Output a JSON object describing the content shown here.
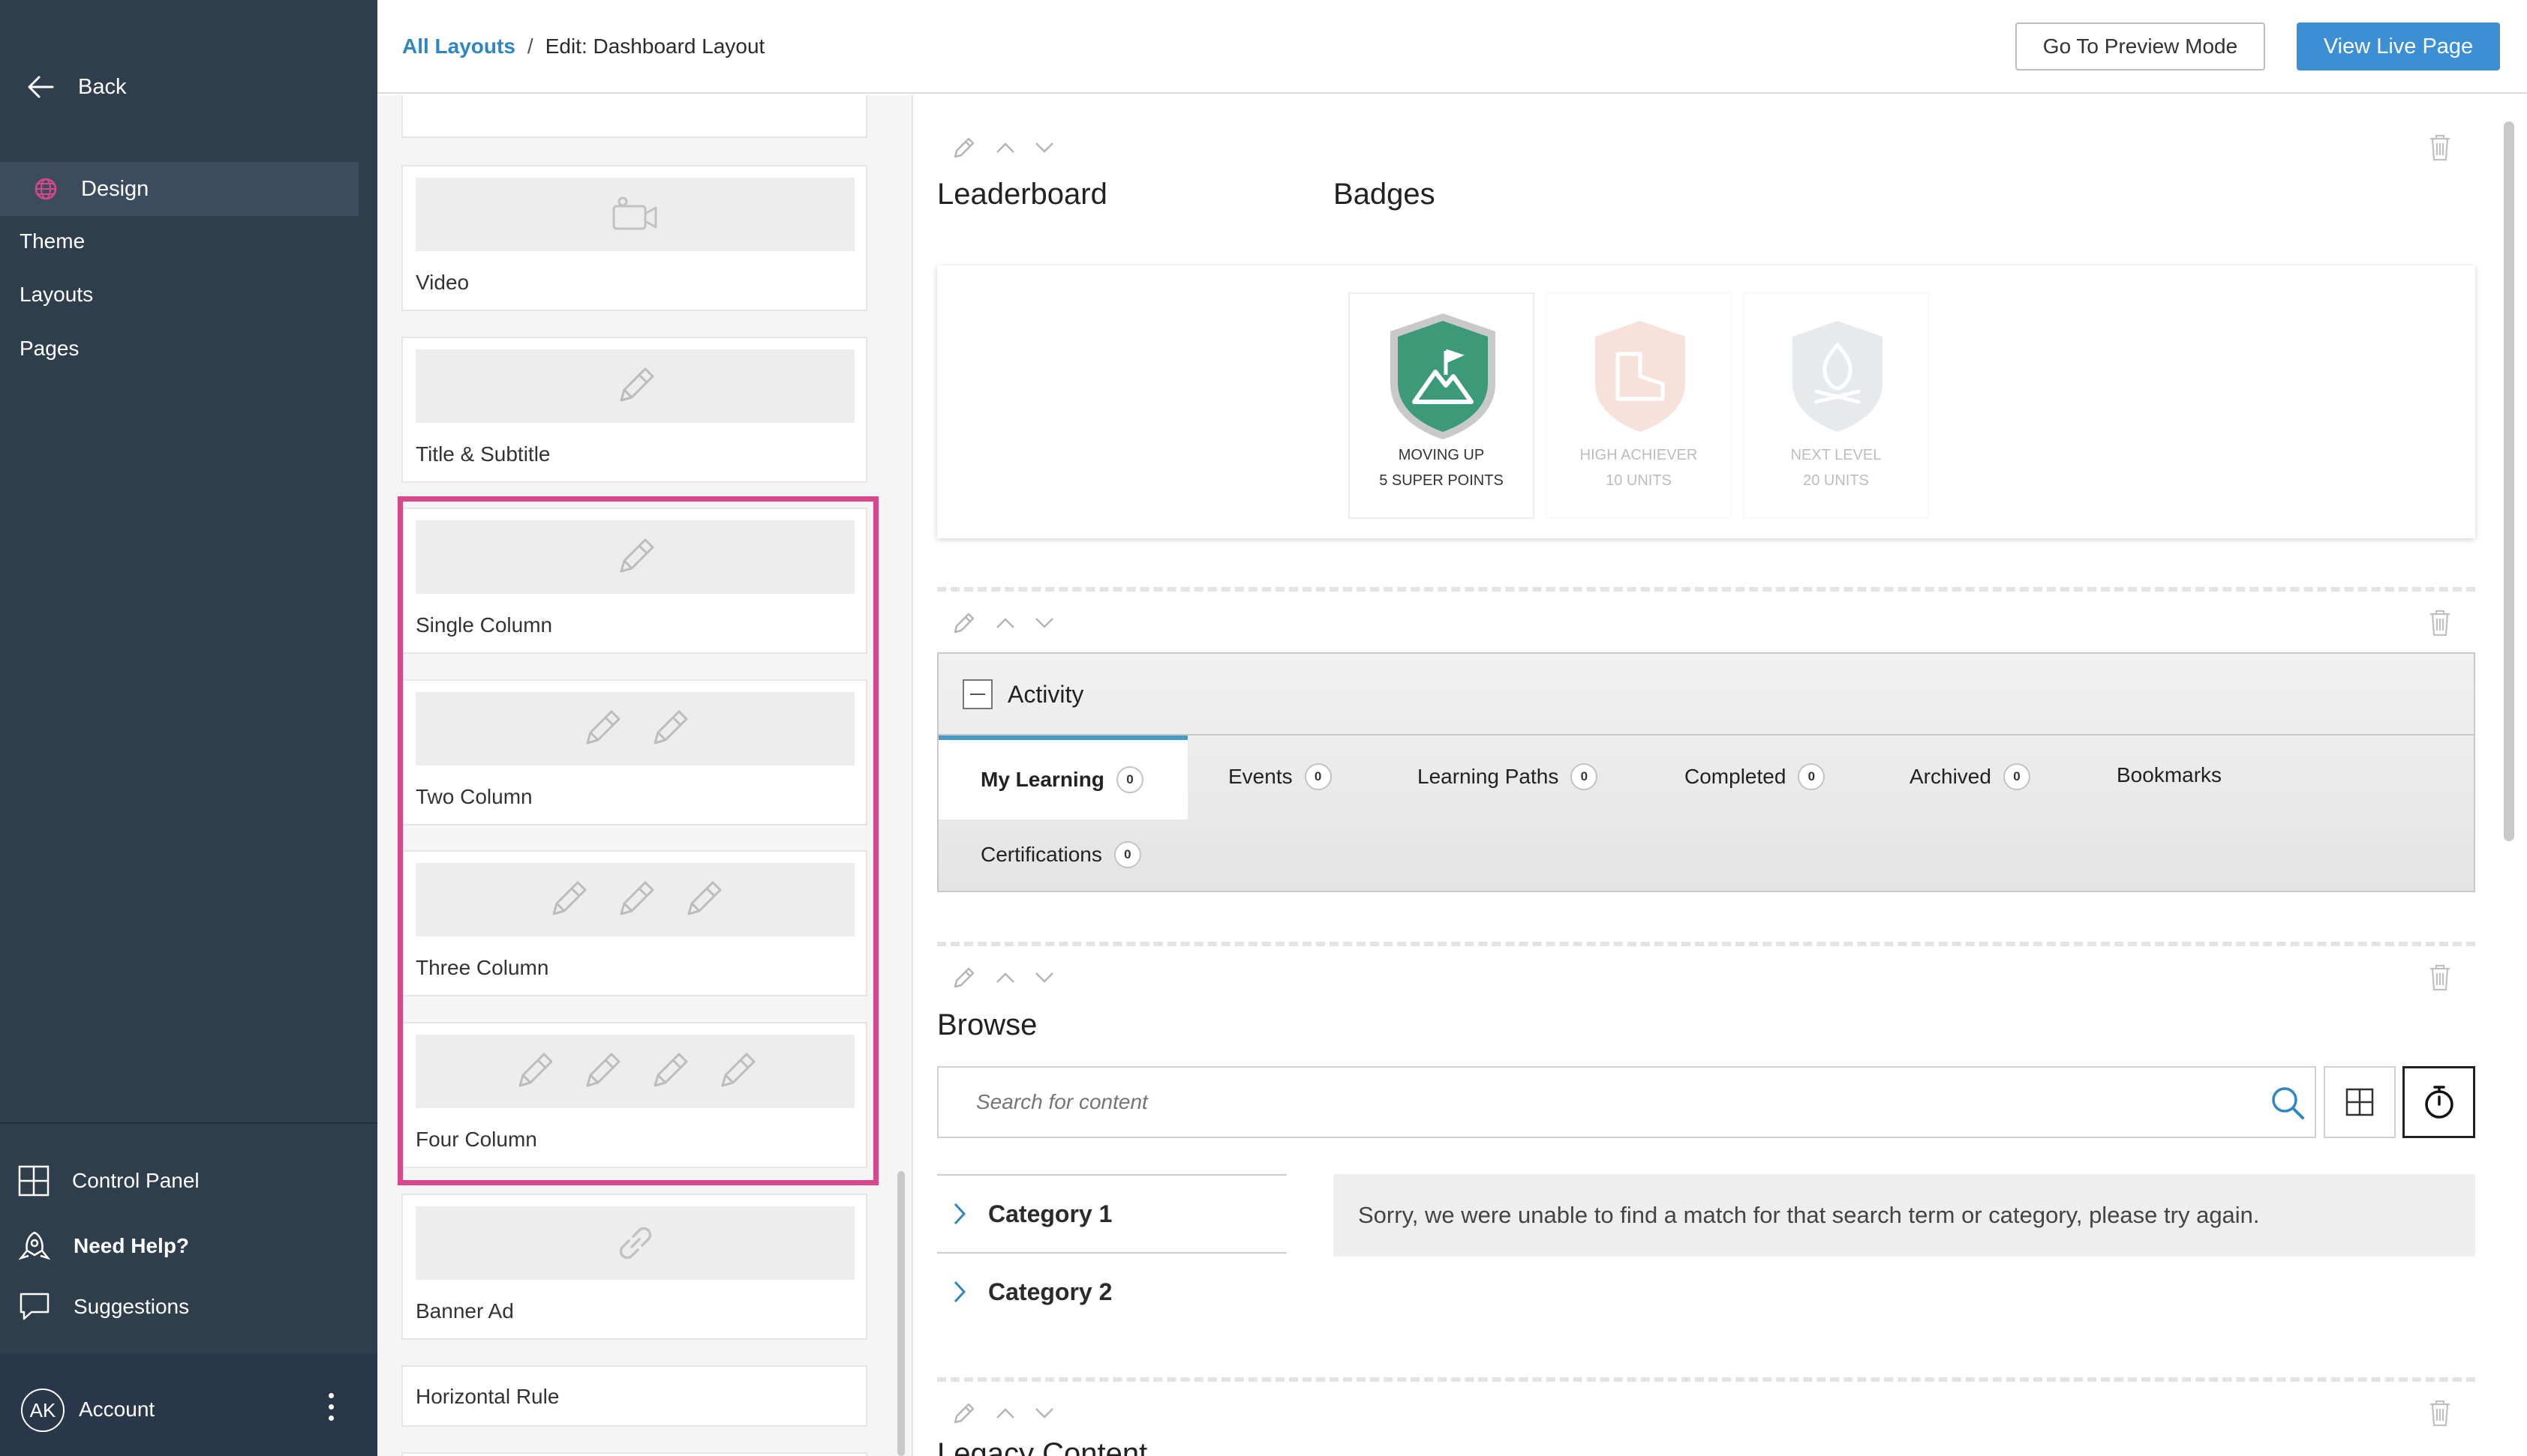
{
  "sidebar": {
    "back_label": "Back",
    "active_item": "Design",
    "items": [
      {
        "label": "Theme",
        "selected": false
      },
      {
        "label": "Layouts",
        "selected": true
      },
      {
        "label": "Pages",
        "selected": false
      }
    ],
    "bottom": [
      {
        "label": "Control Panel",
        "icon": "grid-icon"
      },
      {
        "label": "Need Help?",
        "icon": "help-rocket-icon"
      },
      {
        "label": "Suggestions",
        "icon": "chat-bubble-icon"
      }
    ],
    "account": {
      "initials": "AK",
      "label": "Account"
    }
  },
  "header": {
    "breadcrumb_link": "All Layouts",
    "breadcrumb_sep": "/",
    "breadcrumb_current": "Edit: Dashboard Layout",
    "preview_button": "Go To Preview Mode",
    "live_button": "View Live Page"
  },
  "palette": {
    "items": [
      {
        "label": "Video",
        "icon": "video-camera-icon"
      },
      {
        "label": "Title & Subtitle",
        "icon": "pencil-icon"
      },
      {
        "label": "Single Column",
        "icon": "pencil-icon"
      },
      {
        "label": "Two Column",
        "icon": "pencil-icon"
      },
      {
        "label": "Three Column",
        "icon": "pencil-icon"
      },
      {
        "label": "Four Column",
        "icon": "pencil-icon"
      },
      {
        "label": "Banner Ad",
        "icon": "link-icon"
      },
      {
        "label": "Horizontal Rule",
        "icon": ""
      }
    ],
    "highlight_color": "#d8478a"
  },
  "main": {
    "leaderboard_title": "Leaderboard",
    "badges_title": "Badges",
    "badges": [
      {
        "name": "MOVING UP",
        "points": "5 SUPER POINTS",
        "color": "#3d9a78",
        "locked": false
      },
      {
        "name": "HIGH ACHIEVER",
        "points": "10 UNITS",
        "color": "#e9a593",
        "locked": true
      },
      {
        "name": "NEXT LEVEL",
        "points": "20 UNITS",
        "color": "#b8c0c8",
        "locked": true
      }
    ],
    "activity": {
      "title": "Activity",
      "tabs": [
        {
          "label": "My Learning",
          "count": "0"
        },
        {
          "label": "Events",
          "count": "0"
        },
        {
          "label": "Learning Paths",
          "count": "0"
        },
        {
          "label": "Completed",
          "count": "0"
        },
        {
          "label": "Archived",
          "count": "0"
        },
        {
          "label": "Bookmarks",
          "count": ""
        },
        {
          "label": "Certifications",
          "count": "0"
        }
      ]
    },
    "browse": {
      "title": "Browse",
      "search_placeholder": "Search for content",
      "categories": [
        "Category 1",
        "Category 2"
      ],
      "no_match_message": "Sorry, we were unable to find a match for that search term or category, please try again."
    },
    "legacy_title": "Legacy Content"
  },
  "colors": {
    "sidebar_bg": "#2f3e4d",
    "accent_blue": "#3b8fd2",
    "link_blue": "#2f86c1",
    "tab_underline": "#4a98c5"
  }
}
